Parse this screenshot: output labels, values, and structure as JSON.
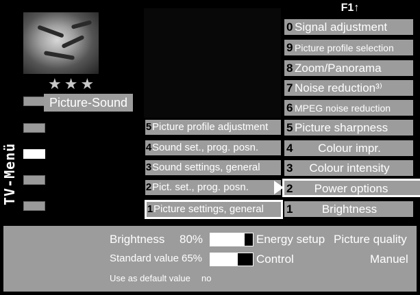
{
  "header": {
    "f1_label": "F1",
    "arrow": "↑"
  },
  "preview": {
    "stars": "★★★",
    "image_icon": "tiger-image"
  },
  "side_menu": {
    "title": "TV-Menü",
    "selected_label": "Picture-Sound",
    "items": 5,
    "selected_index": 2
  },
  "middle_menu": [
    {
      "num": "5",
      "label": "Picture profile adjustment"
    },
    {
      "num": "4",
      "label": "Sound set., prog. posn."
    },
    {
      "num": "3",
      "label": "Sound settings, general"
    },
    {
      "num": "2",
      "label": "Pict. set., prog. posn."
    },
    {
      "num": "1",
      "label": "Picture settings, general"
    }
  ],
  "right_menu": [
    {
      "num": "0",
      "label": "Signal adjustment"
    },
    {
      "num": "9",
      "label": "Picture profile selection"
    },
    {
      "num": "8",
      "label": "Zoom/Panorama"
    },
    {
      "num": "7",
      "label": "Noise reduction³⁾"
    },
    {
      "num": "6",
      "label": "MPEG noise reduction"
    },
    {
      "num": "5",
      "label": "Picture sharpness"
    },
    {
      "num": "4",
      "label": "Colour impr."
    },
    {
      "num": "3",
      "label": "Colour intensity"
    },
    {
      "num": "2",
      "label": "Power options"
    },
    {
      "num": "1",
      "label": "Brightness"
    }
  ],
  "bottom": {
    "brightness_label": "Brightness",
    "brightness_value": "80%",
    "brightness_level": 0.8,
    "standard_label": "Standard value",
    "standard_value": "65%",
    "standard_level": 0.65,
    "energy_setup": "Energy setup",
    "picture_quality": "Picture quality",
    "control": "Control",
    "manuel": "Manuel",
    "default_label": "Use as default value",
    "default_value": "no"
  }
}
